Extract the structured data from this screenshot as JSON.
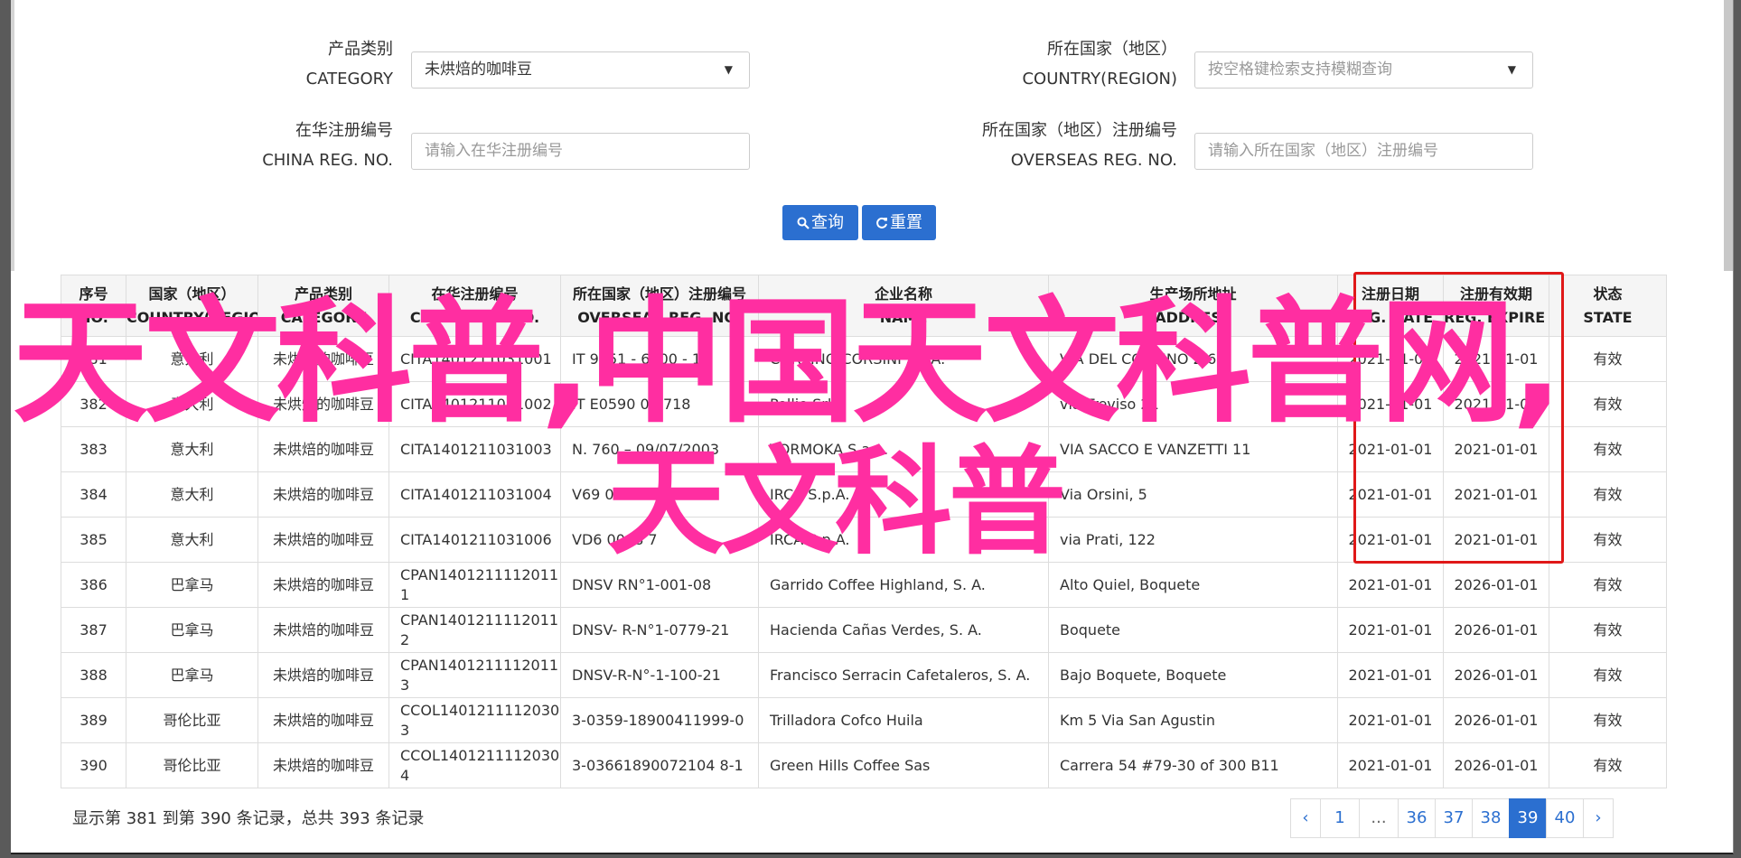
{
  "form": {
    "category_label_cn": "产品类别",
    "category_label_en": "CATEGORY",
    "category_value": "未烘焙的咖啡豆",
    "country_label_cn": "所在国家（地区）",
    "country_label_en": "COUNTRY(REGION)",
    "country_placeholder": "按空格键检索支持模糊查询",
    "china_reg_label_cn": "在华注册编号",
    "china_reg_label_en": "CHINA REG. NO.",
    "china_reg_placeholder": "请输入在华注册编号",
    "overseas_reg_label_cn": "所在国家（地区）注册编号",
    "overseas_reg_label_en": "OVERSEAS REG. NO.",
    "overseas_reg_placeholder": "请输入所在国家（地区）注册编号",
    "search_label": "查询",
    "reset_label": "重置"
  },
  "table": {
    "headers": [
      {
        "cn": "序号",
        "en": "NO."
      },
      {
        "cn": "国家（地区）",
        "en": "COUNTRY(REGIO..."
      },
      {
        "cn": "产品类别",
        "en": "CATEGORY"
      },
      {
        "cn": "在华注册编号",
        "en": "CHINA REG. NO."
      },
      {
        "cn": "所在国家（地区）注册编号",
        "en": "OVERSEAS REG. NO."
      },
      {
        "cn": "企业名称",
        "en": "NAME"
      },
      {
        "cn": "生产场所地址",
        "en": "ADDRESS"
      },
      {
        "cn": "注册日期",
        "en": "REG. DATE"
      },
      {
        "cn": "注册有效期",
        "en": "REG. EXPIRE ..."
      },
      {
        "cn": "状态",
        "en": "STATE"
      }
    ],
    "rows": [
      [
        "381",
        "意大利",
        "未烘焙的咖啡豆",
        "CITA1401211031001",
        "IT 9051 - 6000 - 1",
        "CORSINO CORSINI S.P.A.",
        "VIA DEL CORSINO 2/64",
        "2021-01-01",
        "2021-01-01",
        "有效"
      ],
      [
        "382",
        "意大利",
        "未烘焙的咖啡豆",
        "CITA1401211031002",
        "IT E0590 0 0718",
        "Pollio Srl",
        "via Treviso 21",
        "2021-01-01",
        "2021-01-01",
        "有效"
      ],
      [
        "383",
        "意大利",
        "未烘焙的咖啡豆",
        "CITA1401211031003",
        "N. 760 – 09/07/2003",
        "TORMOKA S.a.a.",
        "VIA SACCO E VANZETTI 11",
        "2021-01-01",
        "2021-01-01",
        "有效"
      ],
      [
        "384",
        "意大利",
        "未烘焙的咖啡豆",
        "CITA1401211031004",
        "V69 00 2697",
        "IRCA S.p.A.",
        "Via Orsini, 5",
        "2021-01-01",
        "2021-01-01",
        "有效"
      ],
      [
        "385",
        "意大利",
        "未烘焙的咖啡豆",
        "CITA1401211031006",
        "VD6 0008 7",
        "IRCA S.p.A.",
        "via Prati, 122",
        "2021-01-01",
        "2021-01-01",
        "有效"
      ],
      [
        "386",
        "巴拿马",
        "未烘焙的咖啡豆",
        "CPAN14012111120111",
        "DNSV RN°1-001-08",
        "Garrido Coffee Highland, S. A.",
        "Alto Quiel, Boquete",
        "2021-01-01",
        "2026-01-01",
        "有效"
      ],
      [
        "387",
        "巴拿马",
        "未烘焙的咖啡豆",
        "CPAN14012111120112",
        "DNSV- R-N°1-0779-21",
        "Hacienda Cañas Verdes, S. A.",
        "Boquete",
        "2021-01-01",
        "2026-01-01",
        "有效"
      ],
      [
        "388",
        "巴拿马",
        "未烘焙的咖啡豆",
        "CPAN14012111120113",
        "DNSV-R-N°-1-100-21",
        "Francisco Serracin Cafetaleros, S. A.",
        "Bajo Boquete, Boquete",
        "2021-01-01",
        "2026-01-01",
        "有效"
      ],
      [
        "389",
        "哥伦比亚",
        "未烘焙的咖啡豆",
        "CCOL14012111120303",
        "3-0359-18900411999-0",
        "Trilladora Cofco Huila",
        "Km 5 Via San Agustin",
        "2021-01-01",
        "2026-01-01",
        "有效"
      ],
      [
        "390",
        "哥伦比亚",
        "未烘焙的咖啡豆",
        "CCOL14012111120304",
        "3-03661890072104 8-1",
        "Green Hills Coffee Sas",
        "Carrera 54 #79-30 of 300 B11",
        "2021-01-01",
        "2026-01-01",
        "有效"
      ]
    ]
  },
  "footer": {
    "summary": "显示第 381 到第 390 条记录，总共 393 条记录",
    "pages": [
      "‹",
      "1",
      "...",
      "36",
      "37",
      "38",
      "39",
      "40",
      "›"
    ],
    "active_page": "39"
  },
  "watermark": {
    "line1": "天文科普,中国天文科普网,",
    "line2": "天文科普"
  },
  "colors": {
    "primary": "#2b6fd0",
    "highlight_box": "#e01818",
    "watermark": "#ff2ea1"
  }
}
